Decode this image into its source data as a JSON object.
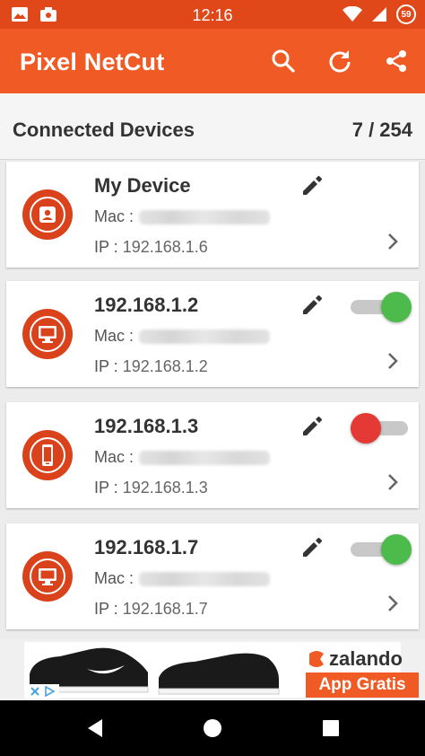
{
  "status_bar": {
    "time": "12:16",
    "battery_level": "59",
    "left_icons": [
      "image-icon",
      "photo-notification-icon"
    ],
    "right_icons": [
      "wifi-icon",
      "signal-icon",
      "battery-icon"
    ]
  },
  "app_bar": {
    "title": "Pixel NetCut",
    "actions": [
      "search-icon",
      "refresh-icon",
      "share-icon"
    ]
  },
  "subheader": {
    "label": "Connected Devices",
    "count": "7 / 254"
  },
  "devices": [
    {
      "name": "My Device",
      "mac_label": "Mac :",
      "ip_label": "IP :",
      "ip": "192.168.1.6",
      "icon": "person-icon",
      "toggle": null
    },
    {
      "name": "192.168.1.2",
      "mac_label": "Mac :",
      "ip_label": "IP :",
      "ip": "192.168.1.2",
      "icon": "monitor-icon",
      "toggle": "on"
    },
    {
      "name": "192.168.1.3",
      "mac_label": "Mac :",
      "ip_label": "IP :",
      "ip": "192.168.1.3",
      "icon": "phone-icon",
      "toggle": "off"
    },
    {
      "name": "192.168.1.7",
      "mac_label": "Mac :",
      "ip_label": "IP :",
      "ip": "192.168.1.7",
      "icon": "monitor-icon",
      "toggle": "on"
    }
  ],
  "ad": {
    "brand": "zalando",
    "cta": "App Gratis"
  },
  "colors": {
    "status_bar": "#e0481a",
    "app_bar": "#f05a24",
    "avatar": "#d9421b",
    "toggle_on": "#4cbb4c",
    "toggle_off": "#e53935"
  },
  "nav_bar": [
    "back-icon",
    "home-icon",
    "recents-icon"
  ]
}
